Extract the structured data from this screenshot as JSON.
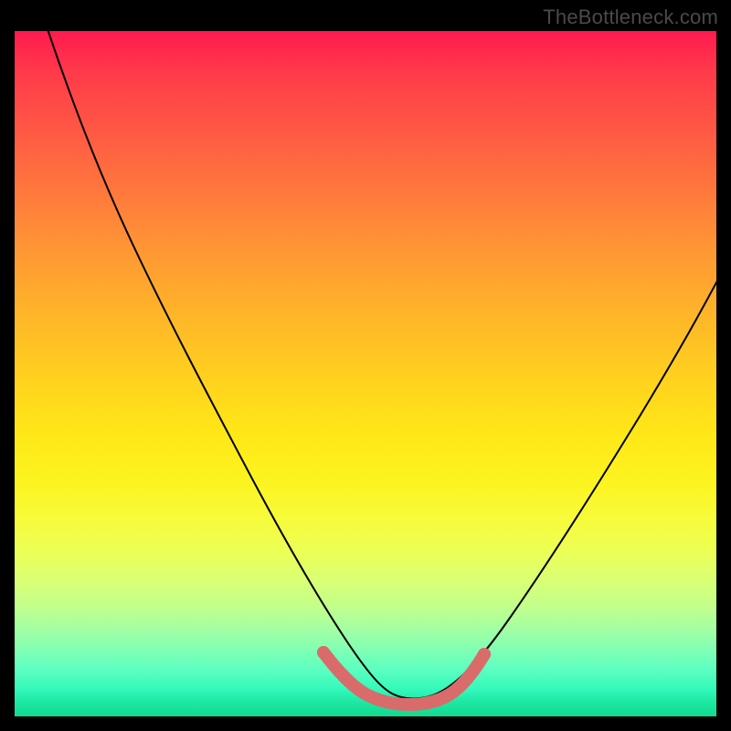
{
  "watermark": "TheBottleneck.com",
  "chart_data": {
    "type": "line",
    "title": "",
    "xlabel": "",
    "ylabel": "",
    "xlim": [
      0,
      100
    ],
    "ylim": [
      0,
      100
    ],
    "gradient_stops": [
      {
        "pos": 0,
        "color": "#ff1a4f"
      },
      {
        "pos": 15,
        "color": "#ff5a44"
      },
      {
        "pos": 33,
        "color": "#ff9a33"
      },
      {
        "pos": 51,
        "color": "#ffd21e"
      },
      {
        "pos": 66,
        "color": "#fcf420"
      },
      {
        "pos": 80,
        "color": "#daff73"
      },
      {
        "pos": 90,
        "color": "#84ffb2"
      },
      {
        "pos": 100,
        "color": "#12d98f"
      }
    ],
    "series": [
      {
        "name": "bottleneck-curve",
        "x": [
          0,
          6,
          12,
          18,
          24,
          30,
          36,
          42,
          47,
          50,
          52,
          54,
          57,
          60,
          64,
          70,
          78,
          88,
          100
        ],
        "y": [
          100,
          90,
          78,
          66,
          54,
          42,
          30,
          18,
          8,
          3,
          1,
          0,
          0,
          1,
          4,
          10,
          20,
          34,
          52
        ]
      },
      {
        "name": "highlight-band",
        "x": [
          45,
          48,
          51,
          54,
          57,
          60,
          63
        ],
        "y": [
          6,
          3,
          1,
          0,
          0,
          1,
          4
        ]
      }
    ],
    "highlight_color": "#d96b6b"
  }
}
